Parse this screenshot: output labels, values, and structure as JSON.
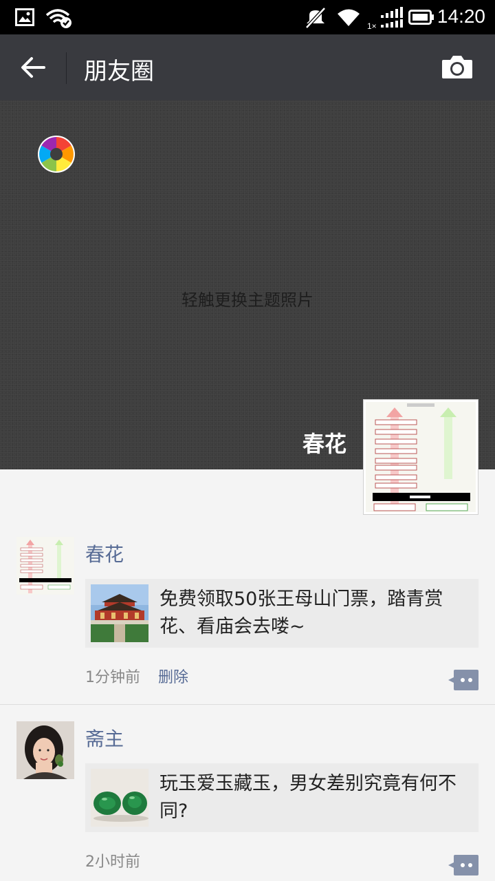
{
  "status_bar": {
    "time": "14:20",
    "icons": [
      "image-icon",
      "wifi-check-icon",
      "mute-icon",
      "wifi-icon",
      "signal-icon",
      "battery-icon"
    ]
  },
  "nav": {
    "title": "朋友圈",
    "back_icon": "back-arrow-icon",
    "camera_icon": "camera-icon",
    "bg_color": "#393a3f"
  },
  "cover": {
    "hint": "轻触更换主题照片",
    "username": "春花"
  },
  "posts": [
    {
      "name": "春花",
      "link_text": "免费领取50张王母山门票，踏青赏花、看庙会去喽~",
      "time": "1分钟前",
      "delete_label": "删除"
    },
    {
      "name": "斋主",
      "link_text": "玩玉爱玉藏玉，男女差别究竟有何不同?",
      "time": "2小时前"
    }
  ],
  "colors": {
    "name_link": "#576b95",
    "feed_bg": "#f4f4f4",
    "card_bg": "#ebebeb"
  }
}
